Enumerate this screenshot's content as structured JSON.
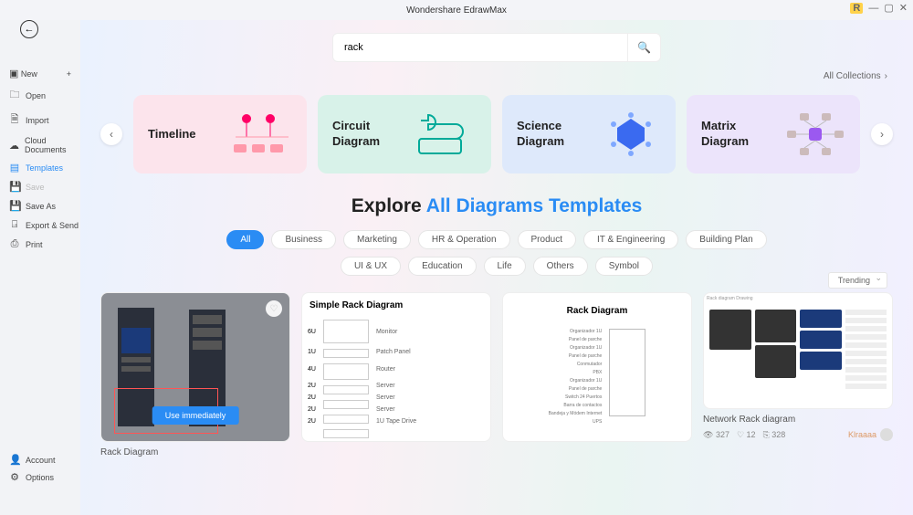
{
  "window": {
    "title": "Wondershare EdrawMax",
    "user_badge": "R"
  },
  "sidebar": {
    "new": "New",
    "open": "Open",
    "import": "Import",
    "cloud": "Cloud Documents",
    "templates": "Templates",
    "save": "Save",
    "saveas": "Save As",
    "export": "Export & Send",
    "print": "Print",
    "account": "Account",
    "options": "Options"
  },
  "search": {
    "value": "rack"
  },
  "collections_link": "All Collections",
  "cards": {
    "timeline": "Timeline",
    "circuit_l1": "Circuit",
    "circuit_l2": "Diagram",
    "science_l1": "Science",
    "science_l2": "Diagram",
    "matrix_l1": "Matrix",
    "matrix_l2": "Diagram"
  },
  "explore": {
    "prefix": "Explore",
    "highlight": "All Diagrams Templates"
  },
  "chips": {
    "all": "All",
    "business": "Business",
    "marketing": "Marketing",
    "hr": "HR & Operation",
    "product": "Product",
    "it": "IT & Engineering",
    "building": "Building Plan",
    "uiux": "UI & UX",
    "education": "Education",
    "life": "Life",
    "others": "Others",
    "symbol": "Symbol"
  },
  "sort": "Trending",
  "gallery": {
    "item1": {
      "title": "Rack Diagram",
      "button": "Use immediately"
    },
    "item2": {
      "thumb_title": "Simple Rack Diagram",
      "rows": {
        "r1u": "6U",
        "r1l": "Monitor",
        "r2u": "1U",
        "r2l": "Patch Panel",
        "r3u": "4U",
        "r3l": "Router",
        "r4u": "2U",
        "r4l": "Server",
        "r5u": "2U",
        "r5l": "Server",
        "r6u": "2U",
        "r6l": "Server",
        "r7u": "2U",
        "r7l": "1U Tape Drive"
      }
    },
    "item3": {
      "thumb_title": "Rack Diagram",
      "labels": {
        "l1": "Organizador 1U",
        "l2": "Panel de parche",
        "l3": "Organizador 1U",
        "l4": "Panel de parche",
        "l5": "Conmutador",
        "l6": "PBX",
        "l7": "Organizador 1U",
        "l8": "Panel de parche",
        "l9": "Switch 24 Puertos",
        "l10": "Barra de contactos",
        "l11": "Bandeja y Módem Internet",
        "l12": "UPS"
      }
    },
    "item4": {
      "title": "Network Rack diagram",
      "views": "327",
      "likes": "12",
      "copies": "328",
      "author": "Klraaaa",
      "thumb_label": "Rack diagram Drawing"
    }
  }
}
